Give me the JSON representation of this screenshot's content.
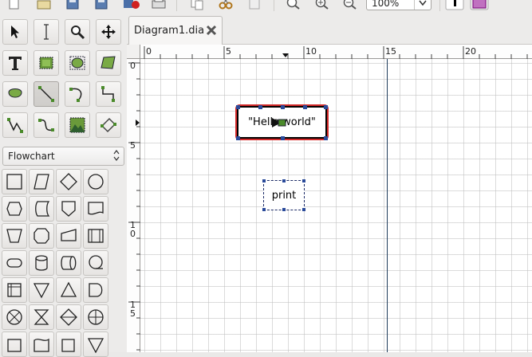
{
  "toolbar": {
    "zoom_value": "100%",
    "icons": [
      "new-icon",
      "open-icon",
      "save-icon",
      "save-as-icon",
      "export-icon",
      "print-icon",
      "copy-icon",
      "cut-icon",
      "paste-icon",
      "zoom-fit-icon",
      "zoom-in-icon",
      "zoom-out-icon",
      "color-icon",
      "layers-icon"
    ]
  },
  "sheet_selector": {
    "selected": "Flowchart"
  },
  "tabs": [
    {
      "label": "Diagram1.dia"
    }
  ],
  "rulers": {
    "horizontal": [
      "0",
      "5",
      "10",
      "15",
      "20"
    ],
    "vertical": [
      "0",
      "5",
      "1\n0",
      "1\n5"
    ]
  },
  "diagram": {
    "hello_text": "\"Hello world\"",
    "print_text": "print"
  },
  "colors": {
    "selection": "#d42a2a",
    "page_break": "#1e3a5a",
    "handle": "#2a4a9a"
  }
}
